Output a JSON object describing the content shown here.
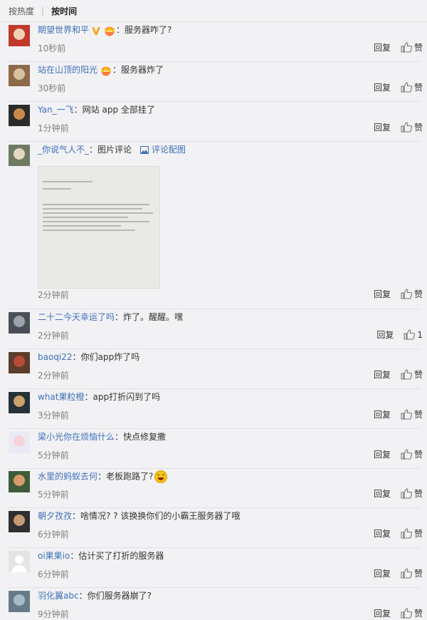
{
  "sort": {
    "hot": "按热度",
    "time": "按时间"
  },
  "reply_label": "回复",
  "like_label": "赞",
  "comments": [
    {
      "user": "期望世界和平",
      "text": "服务器咋了?",
      "time": "10秒前",
      "likes": "赞"
    },
    {
      "user": "站在山顶的阳光",
      "text": "服务器炸了",
      "time": "30秒前",
      "likes": "赞"
    },
    {
      "user": "Yan_一飞",
      "text": "网站 app 全部挂了",
      "time": "1分钟前",
      "likes": "赞"
    },
    {
      "user": "_你说气人不_",
      "text": "图片评论",
      "pic_label": "评论配图",
      "time": "2分钟前",
      "likes": "赞"
    },
    {
      "user": "二十二今天幸运了吗",
      "text": "炸了。醒醒。嘿",
      "time": "2分钟前",
      "likes": "1"
    },
    {
      "user": "baoqi22",
      "text": "你们app炸了吗",
      "time": "2分钟前",
      "likes": "赞"
    },
    {
      "user": "what果粒橙",
      "text": "app打折闪到了吗",
      "time": "3分钟前",
      "likes": "赞"
    },
    {
      "user": "梁小光你在烦恼什么",
      "text": "快点修复撒",
      "time": "5分钟前",
      "likes": "赞"
    },
    {
      "user": "水里的蚂蚁去何",
      "text": "老板跑路了?",
      "time": "5分钟前",
      "likes": "赞"
    },
    {
      "user": "朝夕孜孜",
      "text": "啥情况? ? 该换换你们的小霸王服务器了哦",
      "time": "6分钟前",
      "likes": "赞"
    },
    {
      "user": "oi果果io",
      "text": "估计买了打折的服务器",
      "time": "6分钟前",
      "likes": "赞"
    },
    {
      "user": "羽化翼abc",
      "text": "你们服务器崩了?",
      "time": "9分钟前",
      "likes": "赞"
    }
  ],
  "colors": {
    "link": "#3d6fb6",
    "time": "#808080",
    "bg": "#f2f2f5"
  }
}
